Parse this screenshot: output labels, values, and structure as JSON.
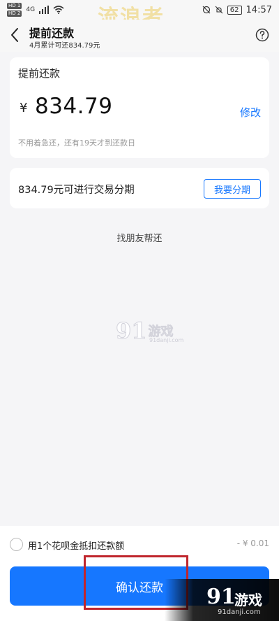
{
  "status_bar": {
    "sim1": "HD 1",
    "sim2": "HD 2",
    "signal": "4G",
    "battery": "62",
    "time": "14:57"
  },
  "watermark": {
    "top_text": "流浪者",
    "logo_num": "91",
    "logo_text": "游戏",
    "site": "91danji.com"
  },
  "header": {
    "title": "提前还款",
    "subtitle": "4月累计可还834.79元"
  },
  "amount_card": {
    "title": "提前还款",
    "currency": "¥",
    "amount": "834.79",
    "modify_label": "修改",
    "hint": "不用着急还，还有19天才到还款日"
  },
  "installment_card": {
    "text": "834.79元可进行交易分期",
    "button_label": "我要分期"
  },
  "friend_link": "找朋友帮还",
  "bottom": {
    "deduct_label": "用1个花呗金抵扣还款额",
    "deduct_value": "- ¥ 0.01",
    "confirm_label": "确认还款"
  },
  "colors": {
    "accent": "#1677ff",
    "highlight": "#c0262d"
  }
}
